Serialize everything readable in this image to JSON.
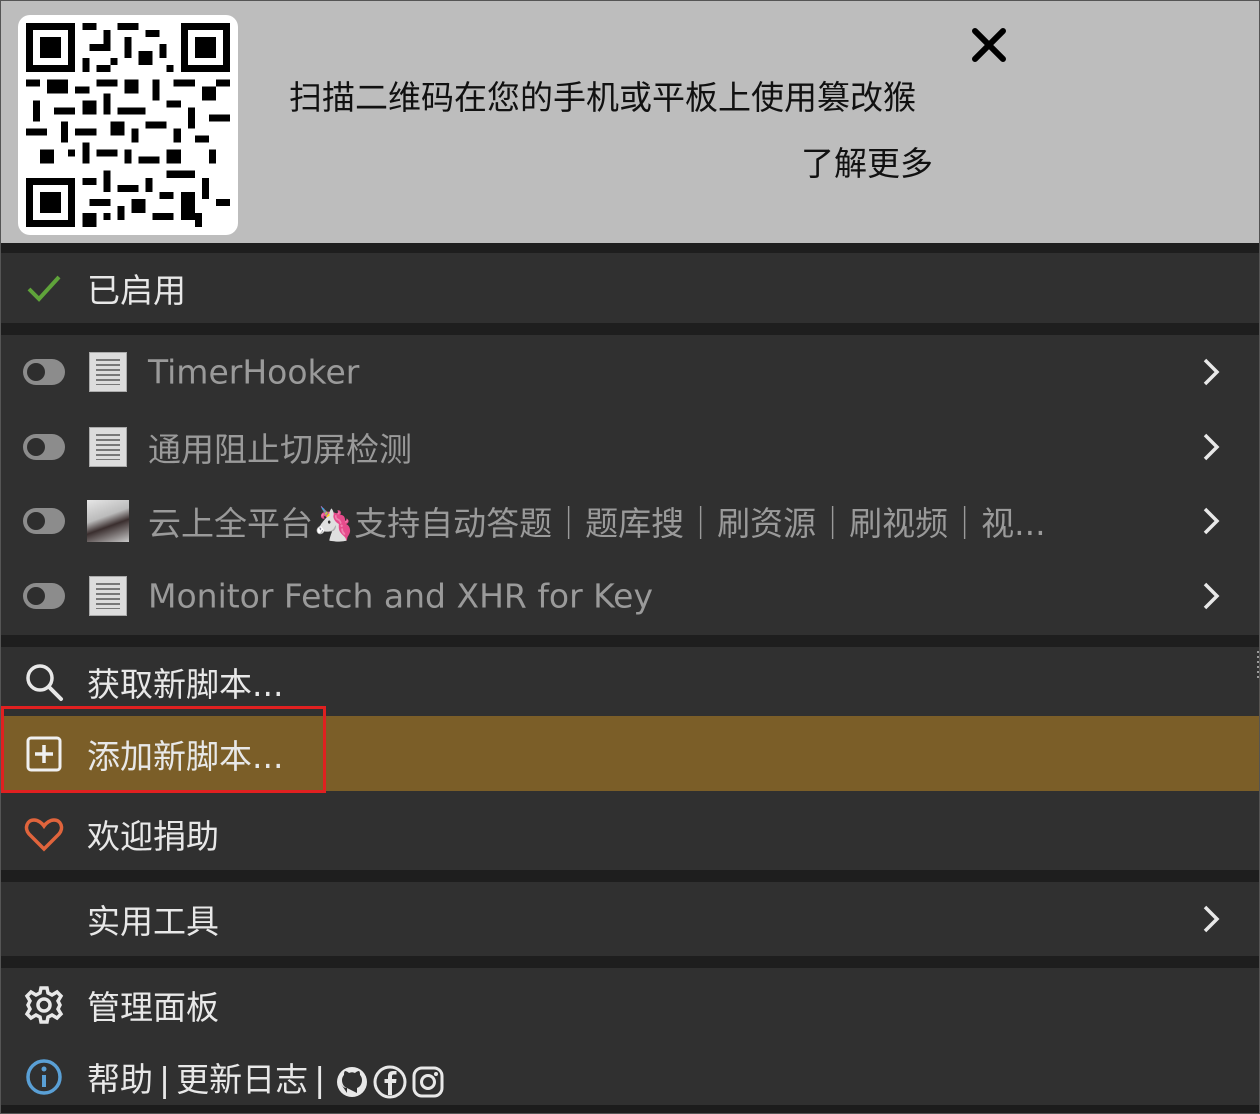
{
  "banner": {
    "text": "扫描二维码在您的手机或平板上使用篡改猴",
    "learn_more": "了解更多"
  },
  "enabled_header": "已启用",
  "scripts": [
    {
      "name": "TimerHooker",
      "icon": "script-file-icon"
    },
    {
      "name": "通用阻止切屏检测",
      "icon": "script-file-icon"
    },
    {
      "name": "云上全平台🦄支持自动答题｜题库搜｜刷资源｜刷视频｜视...",
      "icon": "avatar-icon"
    },
    {
      "name": "Monitor Fetch and XHR for Key",
      "icon": "script-file-icon"
    }
  ],
  "menu": {
    "get_new": "获取新脚本...",
    "add_new": "添加新脚本...",
    "donate": "欢迎捐助",
    "utilities": "实用工具",
    "dashboard": "管理面板"
  },
  "footer": {
    "help": "帮助",
    "sep1": "|",
    "changelog": "更新日志",
    "sep2": "|"
  },
  "colors": {
    "banner_bg": "#bdbdbd",
    "panel_bg": "#303030",
    "highlight": "#7b5e28",
    "check_green": "#5fa33a",
    "heart": "#e0643c",
    "info_blue": "#5aa0d6",
    "annotation_red": "#e02020"
  }
}
